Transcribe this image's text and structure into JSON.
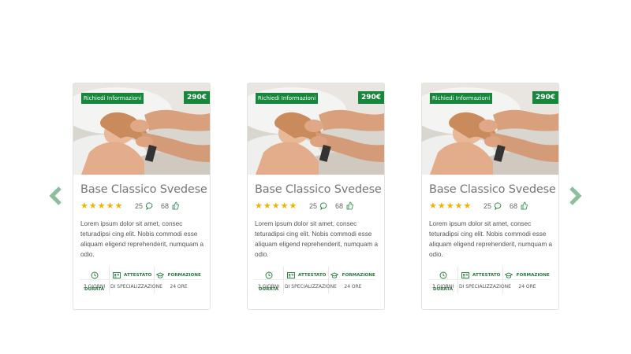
{
  "colors": {
    "accent": "#16873c",
    "star": "#f0b400",
    "arrow": "#8bbf9c"
  },
  "icons": {
    "prev": "chevron-left-icon",
    "next": "chevron-right-icon",
    "comments": "comment-icon",
    "likes": "thumbs-up-icon",
    "durata": "clock-icon",
    "attestato": "certificate-icon",
    "formazione": "graduation-cap-icon"
  },
  "cards": [
    {
      "info_button": "Richiedi Informazioni",
      "price": "290€",
      "title": "Base Classico Svedese",
      "rating": 5,
      "comments": "25",
      "likes": "68",
      "description": "Lorem ipsum dolor sit amet, consec teturadipsi cing elit. Nobis commodi esse aliquam eligend reprehenderit, numquam a odio.",
      "features": [
        {
          "label": "DURATA",
          "value": "3 GIORNI"
        },
        {
          "label": "ATTESTATO",
          "value": "DI SPECIALIZZAZIONE"
        },
        {
          "label": "FORMAZIONE",
          "value": "24 ORE"
        }
      ]
    },
    {
      "info_button": "Richiedi Informazioni",
      "price": "290€",
      "title": "Base Classico Svedese",
      "rating": 5,
      "comments": "25",
      "likes": "68",
      "description": "Lorem ipsum dolor sit amet, consec teturadipsi cing elit. Nobis commodi esse aliquam eligend reprehenderit, numquam a odio.",
      "features": [
        {
          "label": "DURATA",
          "value": "3 GIORNI"
        },
        {
          "label": "ATTESTATO",
          "value": "DI SPECIALIZZAZIONE"
        },
        {
          "label": "FORMAZIONE",
          "value": "24 ORE"
        }
      ]
    },
    {
      "info_button": "Richiedi Informazioni",
      "price": "290€",
      "title": "Base Classico Svedese",
      "rating": 5,
      "comments": "25",
      "likes": "68",
      "description": "Lorem ipsum dolor sit amet, consec teturadipsi cing elit. Nobis commodi esse aliquam eligend reprehenderit, numquam a odio.",
      "features": [
        {
          "label": "DURATA",
          "value": "3 GIORNI"
        },
        {
          "label": "ATTESTATO",
          "value": "DI SPECIALIZZAZIONE"
        },
        {
          "label": "FORMAZIONE",
          "value": "24 ORE"
        }
      ]
    }
  ]
}
